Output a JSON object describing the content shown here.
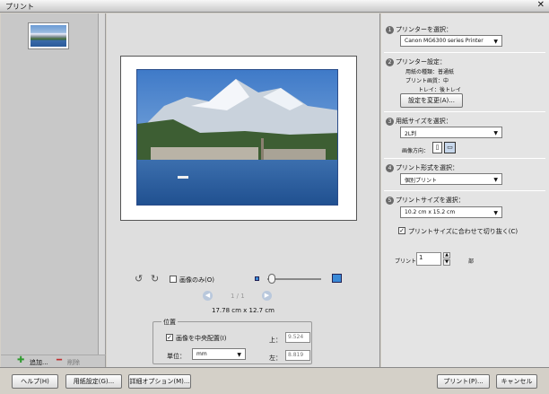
{
  "window": {
    "title": "プリント"
  },
  "left_panel": {
    "add_label": "追加...",
    "remove_label": "削除"
  },
  "center": {
    "image_only_label": "画像のみ(O)",
    "page_indicator": "1 / 1",
    "dimensions": "17.78 cm x 12.7 cm",
    "position": {
      "group_label": "位置",
      "center_label": "画像を中央配置(I)",
      "top_label": "上：",
      "top_value": "9.524",
      "unit_label": "単位：",
      "unit_value": "mm",
      "left_label": "左：",
      "left_value": "8.819"
    }
  },
  "right_panel": {
    "step1": {
      "num": "1",
      "label": "プリンターを選択：",
      "value": "Canon MG6300 series Printer"
    },
    "step2": {
      "num": "2",
      "label": "プリンター設定：",
      "paper_type": "用紙の種類：普通紙",
      "quality": "プリント画質：中",
      "tray": "トレイ：後トレイ",
      "change_button": "設定を変更(A)..."
    },
    "step3": {
      "num": "3",
      "label": "用紙サイズを選択：",
      "value": "2L判",
      "orientation_label": "画像方向："
    },
    "step4": {
      "num": "4",
      "label": "プリント形式を選択：",
      "value": "個別プリント"
    },
    "step5": {
      "num": "5",
      "label": "プリントサイズを選択：",
      "value": "10.2 cm x 15.2 cm",
      "crop_label": "プリントサイズに合わせて切り抜く(C)"
    },
    "copies": {
      "label": "プリント",
      "value": "1",
      "unit": "部"
    }
  },
  "bottom_bar": {
    "help_button": "ヘルプ(H)",
    "page_setup_button": "用紙設定(G)...",
    "more_options_button": "詳細オプション(M)...",
    "print_button": "プリント(P)...",
    "cancel_button": "キャンセル"
  },
  "zoom": {
    "level": 0.08
  },
  "colors": {
    "accent": "#3a8ad8",
    "add": "#2f9a2f",
    "remove": "#c03030"
  }
}
